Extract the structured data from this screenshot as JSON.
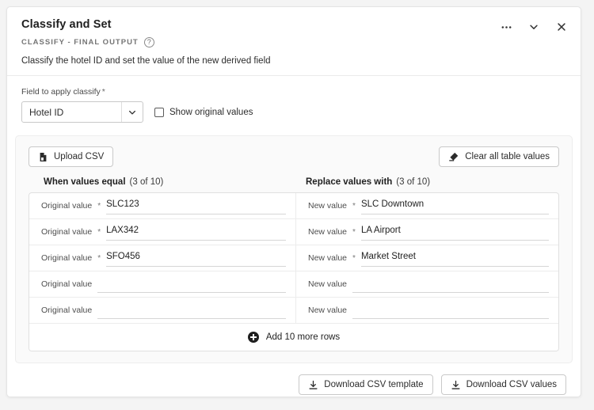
{
  "header": {
    "title": "Classify and Set",
    "eyebrow": "CLASSIFY - FINAL OUTPUT",
    "help_icon": "question-circle-icon",
    "description": "Classify the hotel ID and set the value of the new derived field",
    "actions": [
      {
        "name": "more-options",
        "icon": "ellipsis-icon"
      },
      {
        "name": "collapse",
        "icon": "chevron-down-icon"
      },
      {
        "name": "close",
        "icon": "close-icon"
      }
    ]
  },
  "field_section": {
    "label": "Field to apply classify",
    "required_marker": "*",
    "select_value": "Hotel ID",
    "select_icon": "chevron-down-icon",
    "checkbox_label": "Show original values",
    "checkbox_checked": false
  },
  "toolbar": {
    "upload_label": "Upload CSV",
    "upload_icon": "file-upload-icon",
    "clear_label": "Clear all table values",
    "clear_icon": "eraser-icon"
  },
  "table": {
    "left_header": "When values equal",
    "left_count": "(3 of 10)",
    "right_header": "Replace values with",
    "right_count": "(3 of 10)",
    "left_placeholder": "Original value",
    "right_placeholder": "New value",
    "required_marker": "*",
    "rows": [
      {
        "original": "SLC123",
        "replacement": "SLC Downtown",
        "required": true
      },
      {
        "original": "LAX342",
        "replacement": "LA Airport",
        "required": true
      },
      {
        "original": "SFO456",
        "replacement": "Market Street",
        "required": true
      },
      {
        "original": "",
        "replacement": "",
        "required": false
      },
      {
        "original": "",
        "replacement": "",
        "required": false
      }
    ],
    "add_rows_label": "Add 10 more rows",
    "add_rows_icon": "plus-circle-icon"
  },
  "footer": {
    "download_template_label": "Download CSV template",
    "download_values_label": "Download CSV values",
    "download_icon": "download-icon"
  },
  "colors": {
    "page_background": "#f4f4f4",
    "card_background": "#ffffff",
    "panel_background": "#fafafa",
    "text_primary": "#1f1f1f",
    "text_secondary": "#757575",
    "border": "#e0e0e0"
  }
}
